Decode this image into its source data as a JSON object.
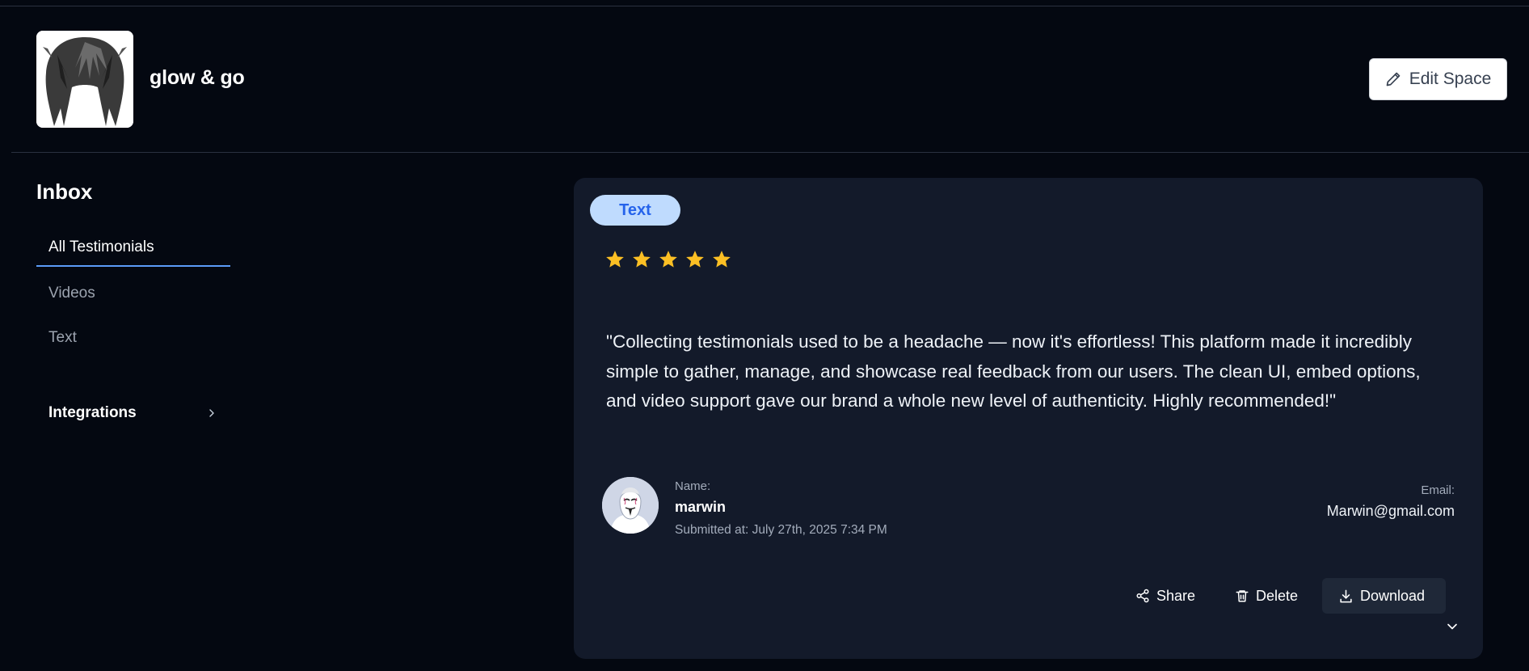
{
  "header": {
    "space_name": "glow & go",
    "edit_button_label": "Edit Space",
    "logo_icon": "anime-hair-avatar-icon",
    "edit_icon": "pencil-icon"
  },
  "sidebar": {
    "title": "Inbox",
    "items": [
      {
        "label": "All Testimonials",
        "active": true
      },
      {
        "label": "Videos",
        "active": false
      },
      {
        "label": "Text",
        "active": false
      }
    ],
    "integrations_label": "Integrations",
    "integrations_icon": "chevron-right-icon"
  },
  "testimonial": {
    "type_badge": "Text",
    "rating": 5,
    "max_rating": 5,
    "star_color": "#fbbf24",
    "text": "\"Collecting testimonials used to be a headache — now it's effortless! This platform made it incredibly simple to gather, manage, and showcase real feedback from our users. The clean UI, embed options, and video support gave our brand a whole new level of authenticity. Highly recommended!\"",
    "name_label": "Name:",
    "name": "marwin",
    "submitted_at": "Submitted at: July 27th, 2025 7:34 PM",
    "email_label": "Email:",
    "email": "Marwin@gmail.com",
    "avatar_icon": "masked-person-avatar-icon"
  },
  "actions": {
    "share_label": "Share",
    "delete_label": "Delete",
    "download_label": "Download",
    "share_icon": "share-icon",
    "delete_icon": "trash-icon",
    "download_icon": "download-icon",
    "expand_icon": "chevron-down-icon"
  },
  "colors": {
    "background": "#040811",
    "card": "#131a2a",
    "accent": "#5b9bf8",
    "badge_bg": "#bfdbfe",
    "badge_text": "#2563eb"
  }
}
